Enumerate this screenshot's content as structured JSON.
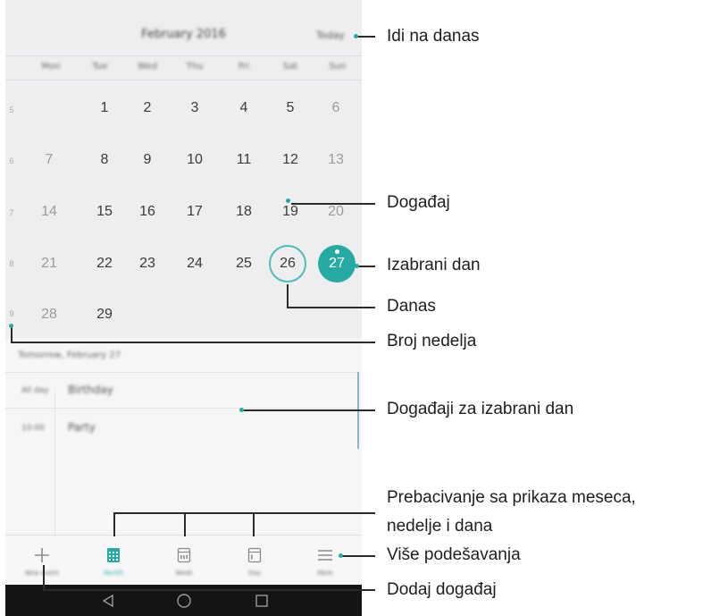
{
  "calendar": {
    "month_title": "February 2016",
    "today_button": "Today",
    "weekdays": [
      "Mon",
      "Tue",
      "Wed",
      "Thu",
      "Fri",
      "Sat",
      "Sun"
    ],
    "weeks": [
      {
        "number": "5",
        "days": [
          "",
          "1",
          "2",
          "3",
          "4",
          "5",
          "6"
        ]
      },
      {
        "number": "6",
        "days": [
          "7",
          "8",
          "9",
          "10",
          "11",
          "12",
          "13"
        ]
      },
      {
        "number": "7",
        "days": [
          "14",
          "15",
          "16",
          "17",
          "18",
          "19",
          "20"
        ]
      },
      {
        "number": "8",
        "days": [
          "21",
          "22",
          "23",
          "24",
          "25",
          "26",
          "27"
        ]
      },
      {
        "number": "9",
        "days": [
          "28",
          "29",
          "",
          "",
          "",
          "",
          ""
        ]
      }
    ],
    "today_day": "26",
    "selected_day": "27",
    "event_days": [
      "19",
      "27"
    ]
  },
  "events": {
    "date_heading": "Tomorrow, February 27",
    "items": [
      {
        "time": "All day",
        "title": "Birthday"
      },
      {
        "time": "10:00",
        "title": "Party"
      }
    ]
  },
  "bottom_bar": {
    "tabs": [
      {
        "label": "New event",
        "icon": "plus-icon"
      },
      {
        "label": "Month",
        "icon": "month-grid-icon"
      },
      {
        "label": "Week",
        "icon": "week-icon"
      },
      {
        "label": "Day",
        "icon": "day-icon"
      },
      {
        "label": "More",
        "icon": "menu-icon"
      }
    ]
  },
  "annotations": {
    "go_to_today": "Idi na danas",
    "event": "Događaj",
    "selected_day": "Izabrani dan",
    "today": "Danas",
    "week_number": "Broj nedelja",
    "events_for_selected_day": "Događaji za izabrani dan",
    "switch_views_line1": "Prebacivanje sa prikaza meseca,",
    "switch_views_line2": "nedelje i dana",
    "more_settings": "Više podešavanja",
    "add_event": "Dodaj događaj"
  },
  "colors": {
    "accent": "#27aaa4",
    "today_ring": "#4dbcb6"
  }
}
